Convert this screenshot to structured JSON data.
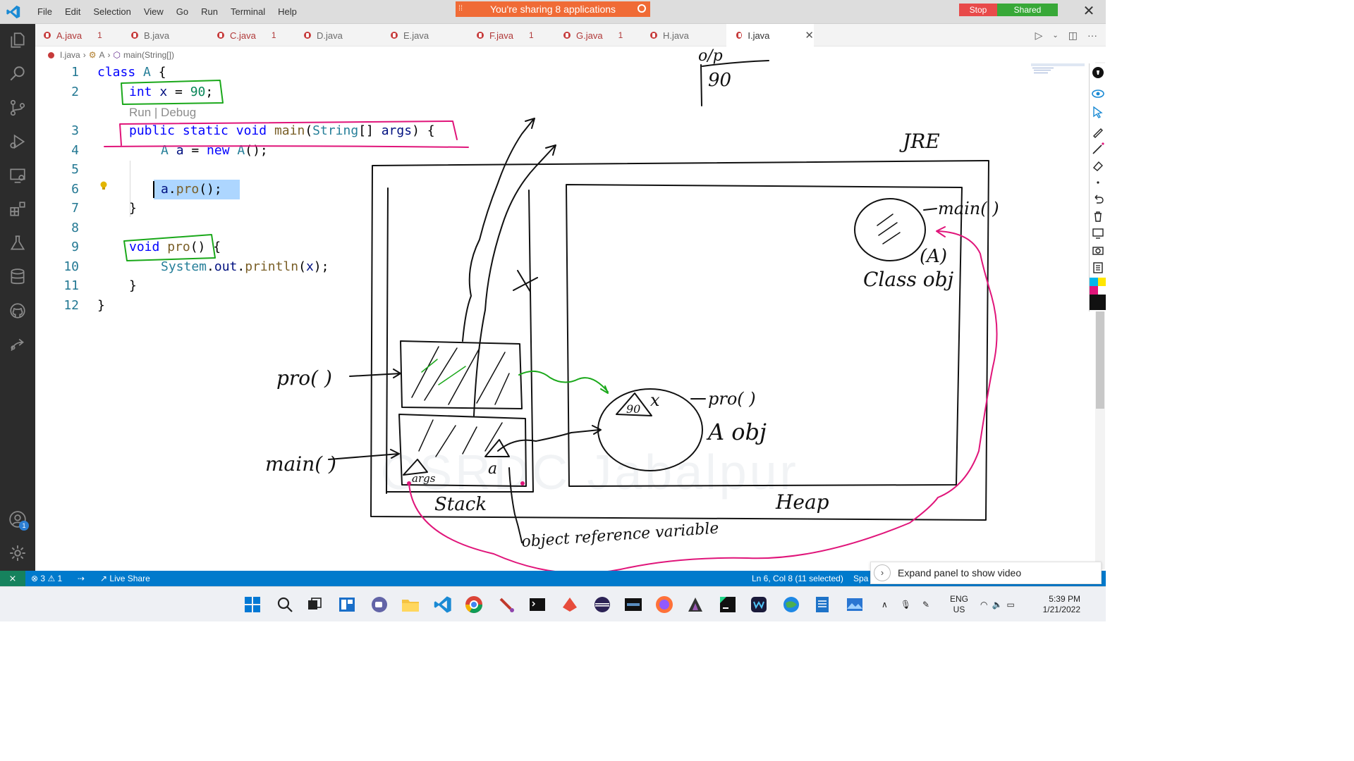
{
  "menu": [
    "File",
    "Edit",
    "Selection",
    "View",
    "Go",
    "Run",
    "Terminal",
    "Help"
  ],
  "share_banner": "You're sharing 8 applications",
  "stop_label": "Stop",
  "shared_label": "Shared",
  "tabs": [
    {
      "name": "A.java",
      "count": "1"
    },
    {
      "name": "B.java",
      "count": ""
    },
    {
      "name": "C.java",
      "count": "1"
    },
    {
      "name": "D.java",
      "count": ""
    },
    {
      "name": "E.java",
      "count": ""
    },
    {
      "name": "F.java",
      "count": "1"
    },
    {
      "name": "G.java",
      "count": "1"
    },
    {
      "name": "H.java",
      "count": ""
    },
    {
      "name": "I.java",
      "count": ""
    }
  ],
  "breadcrumb": [
    "I.java",
    "A",
    "main(String[])"
  ],
  "code": {
    "l1": {
      "kw": "class",
      "name": "A",
      "rest": " {"
    },
    "l2": {
      "kw": "int",
      "var": "x",
      "eq": " = ",
      "num": "90",
      "end": ";"
    },
    "codelens": "Run | Debug",
    "l3": {
      "kw1": "public",
      "kw2": "static",
      "kw3": "void",
      "fn": "main",
      "ty": "String",
      "rest": "[] ",
      "var": "args",
      "end": ") {"
    },
    "l4": {
      "ty": "A",
      "var": "a",
      "eq": " = ",
      "kw": "new",
      "fn": "A",
      "end": "();"
    },
    "l6": {
      "var": "a",
      "dot": ".",
      "fn": "pro",
      "end": "();"
    },
    "l7": "}",
    "l9": {
      "kw": "void",
      "fn": "pro",
      "end": "() {"
    },
    "l10": {
      "ty": "System",
      "dot1": ".",
      "var": "out",
      "dot2": ".",
      "fn": "println",
      "open": "(",
      "arg": "x",
      "end": ");"
    },
    "l11": "}",
    "l12": "}"
  },
  "line_numbers": [
    "1",
    "2",
    "3",
    "4",
    "5",
    "6",
    "7",
    "8",
    "9",
    "10",
    "11",
    "12"
  ],
  "drawing_labels": {
    "op": "o/p",
    "op_value": "90",
    "jre": "JRE",
    "pro_frame": "pro( )",
    "main_frame": "main( )",
    "stack": "Stack",
    "heap": "Heap",
    "args": "args",
    "a_ref": "a",
    "obj_value": "90",
    "obj_var": "x",
    "obj_method": "pro( )",
    "obj_name": "A obj",
    "class_method": "main( )",
    "class_label": "(A)",
    "class_obj": "Class obj",
    "orv": "object reference variable"
  },
  "watermark": "CSRDC Jabalpur",
  "status": {
    "problems_errors": "3",
    "problems_warnings": "1",
    "live_share": "Live Share",
    "cursor": "Ln 6, Col 8 (11 selected)",
    "spaces": "Spa"
  },
  "account_badge": "1",
  "video_panel": "Expand panel to show video",
  "tray": {
    "lang1": "ENG",
    "lang2": "US",
    "time": "5:39 PM",
    "date": "1/21/2022"
  },
  "colors": {
    "accent": "#007acc",
    "share": "#f06b36",
    "stop": "#e84a4a",
    "shared": "#38a838",
    "ink_green": "#1aa81a",
    "ink_pink": "#e0157a"
  }
}
